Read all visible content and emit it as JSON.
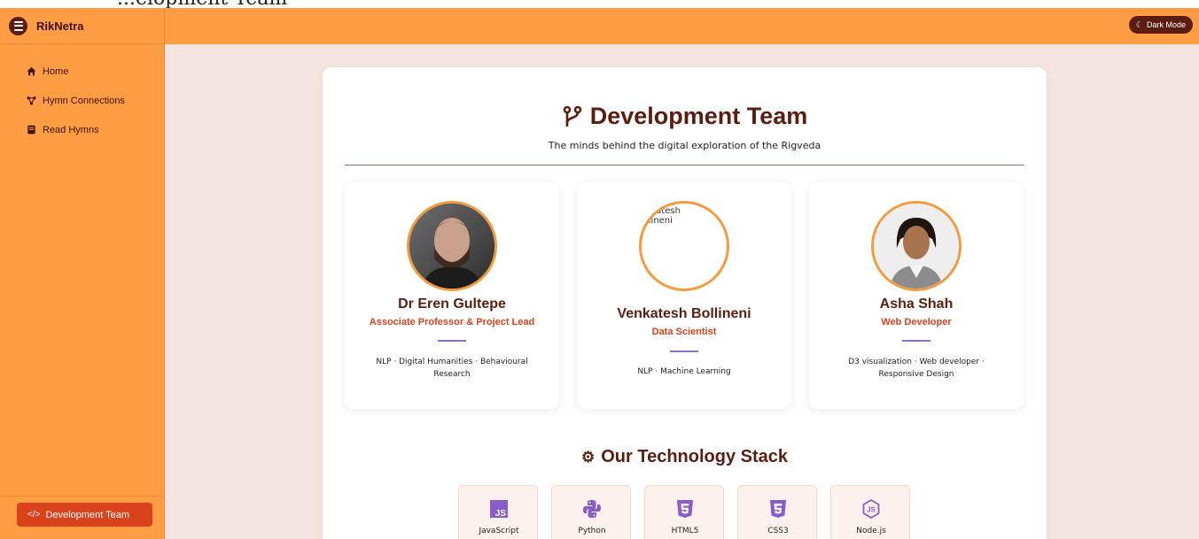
{
  "top_strip": {
    "text": "...elopment Team"
  },
  "app": {
    "brand": "RikNetra"
  },
  "header": {
    "dark_mode_label": "Dark Mode"
  },
  "sidebar": {
    "items": [
      {
        "label": "Home",
        "icon": "home-icon"
      },
      {
        "label": "Hymn Connections",
        "icon": "network-icon"
      },
      {
        "label": "Read Hymns",
        "icon": "book-icon"
      }
    ],
    "active_item": {
      "label": "Development Team",
      "icon": "code-icon"
    }
  },
  "main": {
    "title": "Development Team",
    "subtitle": "The minds behind the digital exploration of the Rigveda",
    "members": [
      {
        "name": "Dr Eren Gultepe",
        "role": "Associate Professor & Project Lead",
        "skills": "NLP · Digital Humanities · Behavioural Research"
      },
      {
        "name": "Venkatesh Bollineni",
        "role": "Data Scientist",
        "skills": "NLP · Machine Learning",
        "image_alt": "Venkatesh Bollineni"
      },
      {
        "name": "Asha Shah",
        "role": "Web Developer",
        "skills": "D3 visualization · Web developer · Responsive Design"
      }
    ],
    "stack_title": "Our Technology Stack",
    "stack": [
      {
        "label": "JavaScript",
        "icon": "javascript-icon"
      },
      {
        "label": "Python",
        "icon": "python-icon"
      },
      {
        "label": "HTML5",
        "icon": "html5-icon"
      },
      {
        "label": "CSS3",
        "icon": "css3-icon"
      },
      {
        "label": "Node.js",
        "icon": "nodejs-icon"
      }
    ]
  },
  "colors": {
    "sidebar": "#ff9d45",
    "brand_dark": "#5a1d0f",
    "accent_red": "#d9421a",
    "page_bg": "#f3e4df",
    "icon_purple": "#8a5cc9"
  }
}
